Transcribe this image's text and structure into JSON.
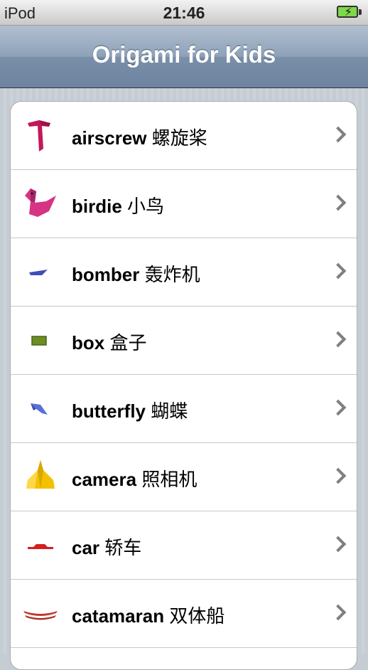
{
  "status_bar": {
    "carrier": "iPod",
    "time": "21:46",
    "battery": "charging"
  },
  "nav": {
    "title": "Origami for Kids"
  },
  "items": [
    {
      "name": "airscrew",
      "cn": "螺旋桨",
      "icon": "airscrew-icon",
      "color": "#c2185b"
    },
    {
      "name": "birdie",
      "cn": "小鸟",
      "icon": "birdie-icon",
      "color": "#d63384"
    },
    {
      "name": "bomber",
      "cn": "轰炸机",
      "icon": "bomber-icon",
      "color": "#3f4fb8"
    },
    {
      "name": "box",
      "cn": "盒子",
      "icon": "box-icon",
      "color": "#6b8e23"
    },
    {
      "name": "butterfly",
      "cn": "蝴蝶",
      "icon": "butterfly-icon",
      "color": "#5a6fd8"
    },
    {
      "name": "camera",
      "cn": "照相机",
      "icon": "camera-icon",
      "color": "#f2c200"
    },
    {
      "name": "car",
      "cn": "轿车",
      "icon": "car-icon",
      "color": "#d32020"
    },
    {
      "name": "catamaran",
      "cn": "双体船",
      "icon": "catamaran-icon",
      "color": "#c0392b"
    }
  ],
  "colors": {
    "nav_gradient_top": "#b2c0d0",
    "nav_gradient_bottom": "#6d83a0",
    "chevron": "#7f7f7f"
  }
}
